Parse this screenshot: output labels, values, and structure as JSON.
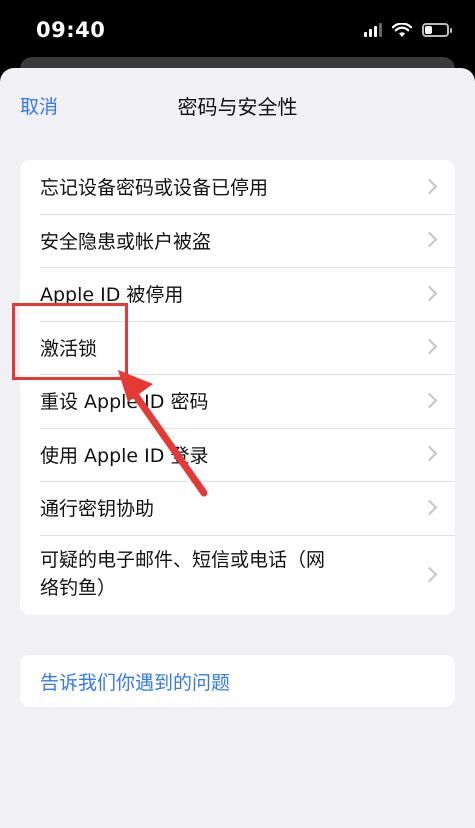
{
  "status_bar": {
    "time": "09:40",
    "battery_level": 0.3
  },
  "nav": {
    "cancel_label": "取消",
    "title": "密码与安全性"
  },
  "menu": {
    "items": [
      {
        "label": "忘记设备密码或设备已停用"
      },
      {
        "label": "安全隐患或帐户被盗"
      },
      {
        "label": "Apple ID 被停用"
      },
      {
        "label": "激活锁"
      },
      {
        "label": "重设 Apple ID 密码"
      },
      {
        "label": "使用 Apple ID 登录"
      },
      {
        "label": "通行密钥协助"
      },
      {
        "label": "可疑的电子邮件、短信或电话（网络钓鱼）"
      }
    ]
  },
  "report": {
    "label": "告诉我们你遇到的问题"
  },
  "colors": {
    "accent": "#3478f6",
    "annotation": "#e53935"
  },
  "icons": [
    "cellular-signal-icon",
    "wifi-icon",
    "battery-icon",
    "chevron-right-icon"
  ]
}
